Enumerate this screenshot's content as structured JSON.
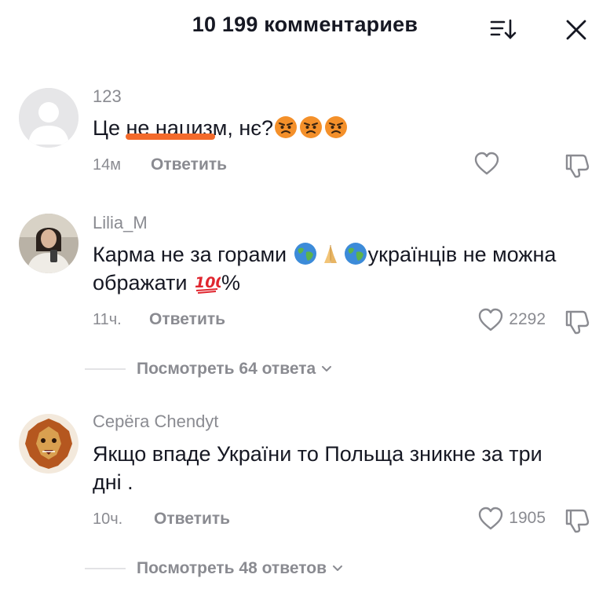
{
  "header": {
    "title": "10 199 комментариев"
  },
  "comments": [
    {
      "username": "123",
      "text_before": "Це ",
      "text_underlined": "не нацизм",
      "text_after": ", нє?",
      "emojis": [
        "angry-face",
        "angry-face",
        "angry-face"
      ],
      "time": "14м",
      "reply_label": "Ответить",
      "likes": ""
    },
    {
      "username": "Lilia_M",
      "text_part1": "Карма не за горами ",
      "text_part2": "українців не можна ображати ",
      "text_part3": "%",
      "emojis": [
        "globe-icon",
        "praying-hands-icon",
        "globe-icon"
      ],
      "emoji_after": "hundred-points-icon",
      "time": "11ч.",
      "reply_label": "Ответить",
      "likes": "2292",
      "view_replies": "Посмотреть 64 ответа"
    },
    {
      "username": "Серёга Chendyt",
      "text": "Якщо впаде України то Польща зникне за три дні .",
      "time": "10ч.",
      "reply_label": "Ответить",
      "likes": "1905",
      "view_replies": "Посмотреть 48 ответов"
    }
  ],
  "colors": {
    "text": "#161823",
    "muted": "#8a8b91",
    "underline": "#f36a2b"
  }
}
